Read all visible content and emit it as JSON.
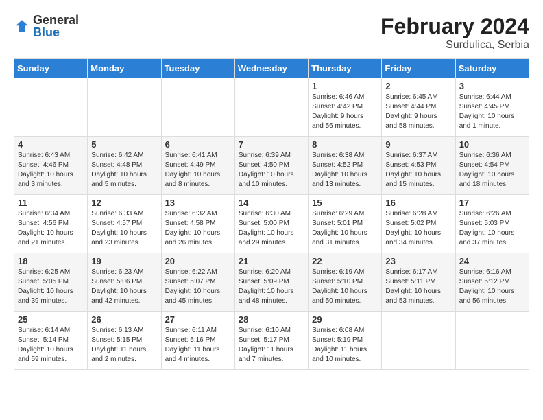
{
  "logo": {
    "general": "General",
    "blue": "Blue"
  },
  "title": "February 2024",
  "subtitle": "Surdulica, Serbia",
  "days_of_week": [
    "Sunday",
    "Monday",
    "Tuesday",
    "Wednesday",
    "Thursday",
    "Friday",
    "Saturday"
  ],
  "weeks": [
    [
      {
        "day": "",
        "info": ""
      },
      {
        "day": "",
        "info": ""
      },
      {
        "day": "",
        "info": ""
      },
      {
        "day": "",
        "info": ""
      },
      {
        "day": "1",
        "info": "Sunrise: 6:46 AM\nSunset: 4:42 PM\nDaylight: 9 hours\nand 56 minutes."
      },
      {
        "day": "2",
        "info": "Sunrise: 6:45 AM\nSunset: 4:44 PM\nDaylight: 9 hours\nand 58 minutes."
      },
      {
        "day": "3",
        "info": "Sunrise: 6:44 AM\nSunset: 4:45 PM\nDaylight: 10 hours\nand 1 minute."
      }
    ],
    [
      {
        "day": "4",
        "info": "Sunrise: 6:43 AM\nSunset: 4:46 PM\nDaylight: 10 hours\nand 3 minutes."
      },
      {
        "day": "5",
        "info": "Sunrise: 6:42 AM\nSunset: 4:48 PM\nDaylight: 10 hours\nand 5 minutes."
      },
      {
        "day": "6",
        "info": "Sunrise: 6:41 AM\nSunset: 4:49 PM\nDaylight: 10 hours\nand 8 minutes."
      },
      {
        "day": "7",
        "info": "Sunrise: 6:39 AM\nSunset: 4:50 PM\nDaylight: 10 hours\nand 10 minutes."
      },
      {
        "day": "8",
        "info": "Sunrise: 6:38 AM\nSunset: 4:52 PM\nDaylight: 10 hours\nand 13 minutes."
      },
      {
        "day": "9",
        "info": "Sunrise: 6:37 AM\nSunset: 4:53 PM\nDaylight: 10 hours\nand 15 minutes."
      },
      {
        "day": "10",
        "info": "Sunrise: 6:36 AM\nSunset: 4:54 PM\nDaylight: 10 hours\nand 18 minutes."
      }
    ],
    [
      {
        "day": "11",
        "info": "Sunrise: 6:34 AM\nSunset: 4:56 PM\nDaylight: 10 hours\nand 21 minutes."
      },
      {
        "day": "12",
        "info": "Sunrise: 6:33 AM\nSunset: 4:57 PM\nDaylight: 10 hours\nand 23 minutes."
      },
      {
        "day": "13",
        "info": "Sunrise: 6:32 AM\nSunset: 4:58 PM\nDaylight: 10 hours\nand 26 minutes."
      },
      {
        "day": "14",
        "info": "Sunrise: 6:30 AM\nSunset: 5:00 PM\nDaylight: 10 hours\nand 29 minutes."
      },
      {
        "day": "15",
        "info": "Sunrise: 6:29 AM\nSunset: 5:01 PM\nDaylight: 10 hours\nand 31 minutes."
      },
      {
        "day": "16",
        "info": "Sunrise: 6:28 AM\nSunset: 5:02 PM\nDaylight: 10 hours\nand 34 minutes."
      },
      {
        "day": "17",
        "info": "Sunrise: 6:26 AM\nSunset: 5:03 PM\nDaylight: 10 hours\nand 37 minutes."
      }
    ],
    [
      {
        "day": "18",
        "info": "Sunrise: 6:25 AM\nSunset: 5:05 PM\nDaylight: 10 hours\nand 39 minutes."
      },
      {
        "day": "19",
        "info": "Sunrise: 6:23 AM\nSunset: 5:06 PM\nDaylight: 10 hours\nand 42 minutes."
      },
      {
        "day": "20",
        "info": "Sunrise: 6:22 AM\nSunset: 5:07 PM\nDaylight: 10 hours\nand 45 minutes."
      },
      {
        "day": "21",
        "info": "Sunrise: 6:20 AM\nSunset: 5:09 PM\nDaylight: 10 hours\nand 48 minutes."
      },
      {
        "day": "22",
        "info": "Sunrise: 6:19 AM\nSunset: 5:10 PM\nDaylight: 10 hours\nand 50 minutes."
      },
      {
        "day": "23",
        "info": "Sunrise: 6:17 AM\nSunset: 5:11 PM\nDaylight: 10 hours\nand 53 minutes."
      },
      {
        "day": "24",
        "info": "Sunrise: 6:16 AM\nSunset: 5:12 PM\nDaylight: 10 hours\nand 56 minutes."
      }
    ],
    [
      {
        "day": "25",
        "info": "Sunrise: 6:14 AM\nSunset: 5:14 PM\nDaylight: 10 hours\nand 59 minutes."
      },
      {
        "day": "26",
        "info": "Sunrise: 6:13 AM\nSunset: 5:15 PM\nDaylight: 11 hours\nand 2 minutes."
      },
      {
        "day": "27",
        "info": "Sunrise: 6:11 AM\nSunset: 5:16 PM\nDaylight: 11 hours\nand 4 minutes."
      },
      {
        "day": "28",
        "info": "Sunrise: 6:10 AM\nSunset: 5:17 PM\nDaylight: 11 hours\nand 7 minutes."
      },
      {
        "day": "29",
        "info": "Sunrise: 6:08 AM\nSunset: 5:19 PM\nDaylight: 11 hours\nand 10 minutes."
      },
      {
        "day": "",
        "info": ""
      },
      {
        "day": "",
        "info": ""
      }
    ]
  ]
}
